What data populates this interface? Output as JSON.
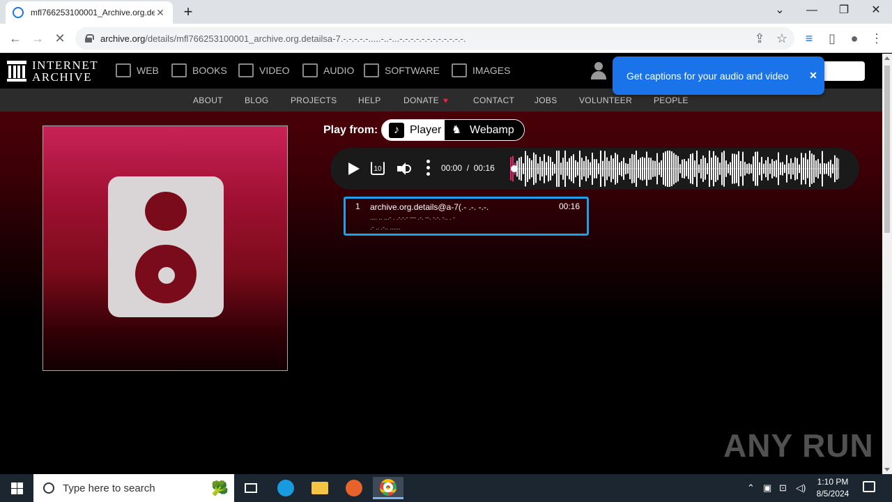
{
  "browser": {
    "tab_title": "mfl766253100001_Archive.org.de",
    "new_tab": "+",
    "url_host": "archive.org",
    "url_path": "/details/mfl766253100001_archive.org.detailsa-7.-.-.-.-.-.....-..-...-.-.-.-.-.-.-.-.-.-.-.-."
  },
  "ia_header": {
    "logo_line1": "INTERNET",
    "logo_line2": "ARCHIVE",
    "media_nav": [
      "WEB",
      "BOOKS",
      "VIDEO",
      "AUDIO",
      "SOFTWARE",
      "IMAGES"
    ],
    "sub_nav": [
      "ABOUT",
      "BLOG",
      "PROJECTS",
      "HELP",
      "DONATE",
      "CONTACT",
      "JOBS",
      "VOLUNTEER",
      "PEOPLE"
    ]
  },
  "caption_popup": {
    "text": "Get captions for your audio and video",
    "close": "✕"
  },
  "player": {
    "play_from_label": "Play from:",
    "options": [
      "Player",
      "Webamp"
    ],
    "selected_option": "Player",
    "current_time": "00:00",
    "separator": "/",
    "total_time": "00:16",
    "rewind_label": "10",
    "progress": 0
  },
  "tracklist": [
    {
      "number": "1",
      "title": "archive.org.details@a-7(.- .-. -.-.",
      "extra": ".... .. ...- . .-.-.- --- .-. --. -.-. -.. . -\n.- .. .-.. ......",
      "duration": "00:16"
    }
  ],
  "watermark": "ANY RUN",
  "taskbar": {
    "search_placeholder": "Type here to search",
    "time": "1:10 PM",
    "date": "8/5/2024"
  },
  "colors": {
    "accent": "#1a73e8",
    "tracklist_border": "#1fa0e8",
    "art_top": "#c92356",
    "speaker_red": "#7a0b1a"
  }
}
